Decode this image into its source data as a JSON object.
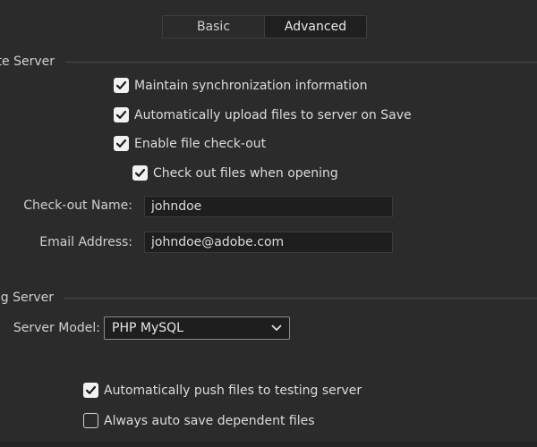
{
  "tabs": [
    {
      "label": "Basic",
      "active": false
    },
    {
      "label": "Advanced",
      "active": true
    }
  ],
  "remote_server": {
    "title": "ote Server",
    "maintain_sync": {
      "label": "Maintain synchronization information",
      "checked": true
    },
    "auto_upload": {
      "label": "Automatically upload files to server on Save",
      "checked": true
    },
    "enable_checkout": {
      "label": "Enable file check-out",
      "checked": true
    },
    "checkout_when_opening": {
      "label": "Check out files when opening",
      "checked": true
    },
    "checkout_name": {
      "label": "Check-out Name:",
      "value": "johndoe"
    },
    "email_address": {
      "label": "Email Address:",
      "value": "johndoe@adobe.com"
    }
  },
  "testing_server": {
    "title": "ing Server",
    "server_model": {
      "label": "Server Model:",
      "value": "PHP MySQL"
    },
    "auto_push": {
      "label": "Automatically push files to testing server",
      "checked": true
    },
    "auto_save_dependent": {
      "label": "Always auto save dependent files",
      "checked": false
    }
  },
  "colors": {
    "background": "#2b2b2b",
    "field_background": "#1e1e1e",
    "text": "#dcdcdc",
    "checkbox_checked": "#f2f2f2"
  },
  "icons": {
    "checkmark": "checkmark-icon",
    "dropdown": "chevron-down-icon"
  }
}
